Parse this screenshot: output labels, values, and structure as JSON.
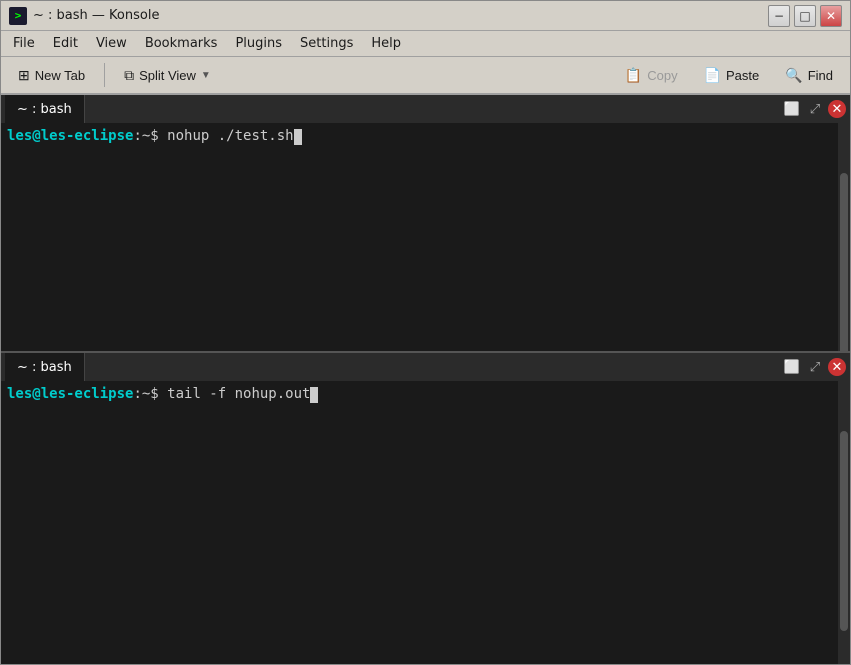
{
  "window": {
    "title": "~ : bash — Konsole",
    "icon": ">"
  },
  "title_bar": {
    "title": "~ : bash — Konsole",
    "minimize_label": "−",
    "maximize_label": "□",
    "close_label": "✕"
  },
  "menu_bar": {
    "items": [
      "File",
      "Edit",
      "View",
      "Bookmarks",
      "Plugins",
      "Settings",
      "Help"
    ]
  },
  "toolbar": {
    "new_tab_label": "New Tab",
    "split_view_label": "Split View",
    "copy_label": "Copy",
    "paste_label": "Paste",
    "find_label": "Find"
  },
  "tab_top": {
    "label": "~ : bash"
  },
  "tab_bottom": {
    "label": "~ : bash"
  },
  "pane_top": {
    "prompt_user": "les@les-eclipse",
    "prompt_dir": "~",
    "command": "nohup ./test.sh"
  },
  "pane_bottom": {
    "prompt_user": "les@les-eclipse",
    "prompt_dir": "~",
    "command": "tail -f nohup.out"
  }
}
